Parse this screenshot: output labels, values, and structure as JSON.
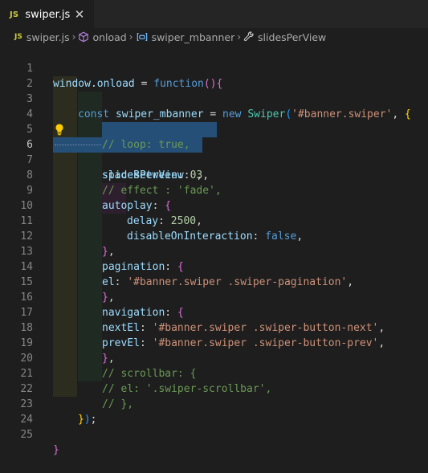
{
  "tab": {
    "badge": "JS",
    "label": "swiper.js",
    "close": "✕"
  },
  "breadcrumb": {
    "file_badge": "JS",
    "file": "swiper.js",
    "sep": "›",
    "onload": "onload",
    "var": "swiper_mbanner",
    "prop": "slidesPerView"
  },
  "lines": [
    {
      "n": "1"
    },
    {
      "n": "2"
    },
    {
      "n": "3"
    },
    {
      "n": "4"
    },
    {
      "n": "5"
    },
    {
      "n": "6"
    },
    {
      "n": "7"
    },
    {
      "n": "8"
    },
    {
      "n": "9"
    },
    {
      "n": "10"
    },
    {
      "n": "11"
    },
    {
      "n": "12"
    },
    {
      "n": "13"
    },
    {
      "n": "14"
    },
    {
      "n": "15"
    },
    {
      "n": "16"
    },
    {
      "n": "17"
    },
    {
      "n": "18"
    },
    {
      "n": "19"
    },
    {
      "n": "20"
    },
    {
      "n": "21"
    },
    {
      "n": "22"
    },
    {
      "n": "23"
    },
    {
      "n": "24"
    },
    {
      "n": "25"
    }
  ],
  "code": {
    "l1": [
      "window",
      ".",
      "onload",
      " = ",
      "function",
      "()",
      "{"
    ],
    "l3": [
      "const",
      " ",
      "swiper_mbanner",
      " = ",
      "new",
      " ",
      "Swiper",
      "(",
      "'#banner.swiper'",
      ", ",
      "{"
    ],
    "l5": "// loop: true,",
    "l6": [
      "slidesPerView",
      ": ",
      "3",
      ","
    ],
    "l7": [
      "spaceBetween",
      ": ",
      "0",
      ","
    ],
    "l8": "// effect : 'fade',",
    "l9": [
      "autoplay",
      ": ",
      "{"
    ],
    "l10": [
      "delay",
      ": ",
      "2500",
      ","
    ],
    "l11": [
      "disableOnInteraction",
      ": ",
      "false",
      ","
    ],
    "l12": [
      "}",
      ","
    ],
    "l13": [
      "pagination",
      ": ",
      "{"
    ],
    "l14": [
      "el",
      ": ",
      "'#banner.swiper .swiper-pagination'",
      ","
    ],
    "l15": [
      "}",
      ","
    ],
    "l16": [
      "navigation",
      ": ",
      "{"
    ],
    "l17": [
      "nextEl",
      ": ",
      "'#banner.swiper .swiper-button-next'",
      ","
    ],
    "l18": [
      "prevEl",
      ": ",
      "'#banner.swiper .swiper-button-prev'",
      ","
    ],
    "l19": [
      "}",
      ","
    ],
    "l20": "// scrollbar: {",
    "l21": "// el: '.swiper-scrollbar',",
    "l22": "// },",
    "l23": [
      "}",
      ")",
      ";"
    ],
    "l25": "}"
  },
  "colors": {
    "background": "#1e1e1e",
    "selection": "#264f78",
    "keyword": "#569cd6",
    "string": "#ce9178",
    "comment": "#6a9955",
    "number": "#b5cea8",
    "variable": "#9cdcfe"
  },
  "icons": {
    "close": "close-icon",
    "method": "cube-icon",
    "variable": "variable-icon",
    "property": "wrench-icon",
    "lightbulb": "lightbulb-icon"
  }
}
